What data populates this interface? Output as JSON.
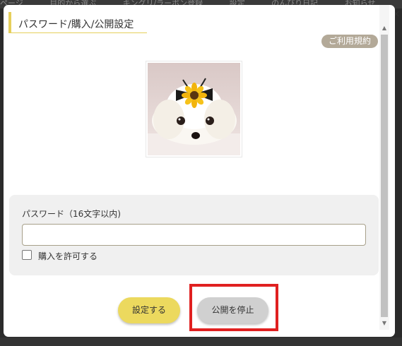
{
  "background_page": {
    "strip_items": [
      "ページ",
      "目的から選ぶ",
      "キングリ/ラーボン登録",
      "設定",
      "のんびり日記",
      "お知らせ"
    ]
  },
  "modal": {
    "title": "パスワード/購入/公開設定",
    "close_symbol": "×",
    "terms_link": "ご利用規約",
    "photo_icon": "dog-photo",
    "form": {
      "password_label": "パスワード（16文字以内)",
      "password_value": "",
      "password_placeholder": "",
      "allow_purchase_label": "購入を許可する",
      "allow_purchase_checked": false
    },
    "buttons": {
      "set_label": "設定する",
      "stop_label": "公開を停止"
    },
    "colors": {
      "accent_yellow": "#ecd95e",
      "terms_badge": "#b3a998",
      "highlight_red": "#e02020"
    }
  }
}
